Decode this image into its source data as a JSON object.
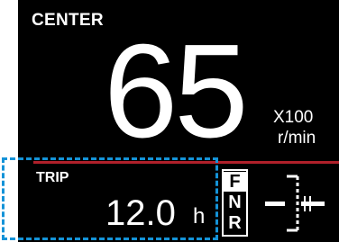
{
  "gauge": {
    "mode_label": "CENTER",
    "rpm_value": "65",
    "rpm_multiplier": "X100",
    "rpm_unit": "r/min"
  },
  "trip": {
    "label": "TRIP",
    "value": "12.0",
    "unit": "h"
  },
  "gear": {
    "positions": [
      "F",
      "N",
      "R"
    ],
    "active": "F"
  },
  "colors": {
    "background": "#000000",
    "divider": "#b0202a",
    "focus_outline": "#1493d8"
  },
  "icons": {
    "trim": "trim-indicator-icon"
  }
}
